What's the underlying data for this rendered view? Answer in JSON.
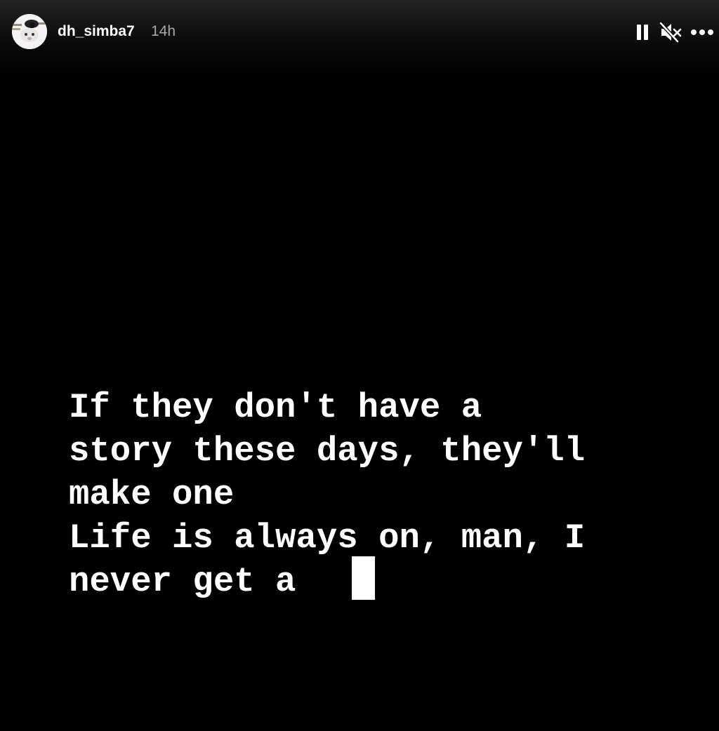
{
  "header": {
    "username": "dh_simba7",
    "timestamp": "14h",
    "icons": {
      "avatar": "avatar",
      "pause": "pause-icon",
      "mute": "speaker-muted-icon",
      "more": "more-horizontal-icon"
    }
  },
  "story": {
    "lines": [
      "If they don't have a",
      "story these days, they'll",
      "make one",
      "Life is always on, man, I",
      "never get a"
    ]
  },
  "colors": {
    "background": "#000000",
    "text": "#ffffff",
    "timestamp": "#a8a8a8"
  }
}
